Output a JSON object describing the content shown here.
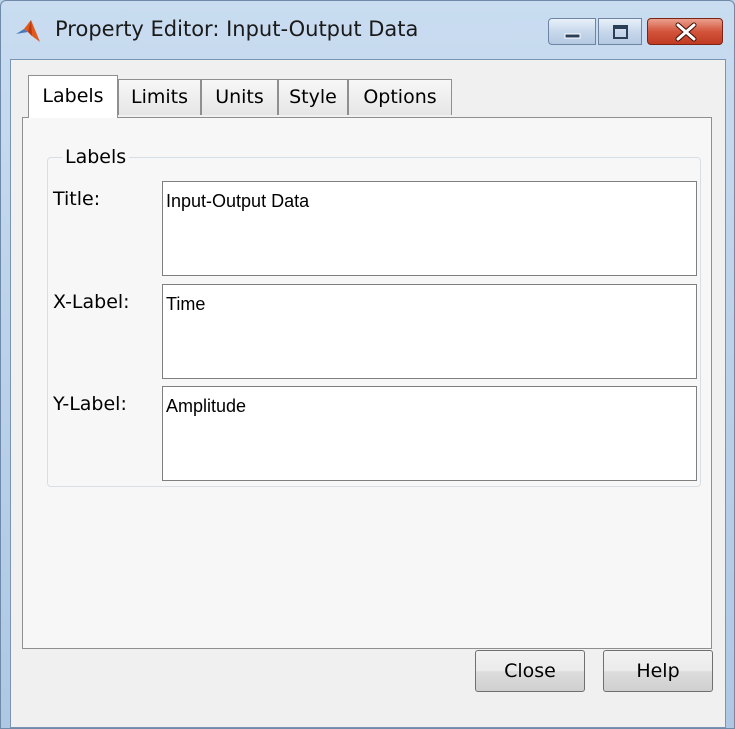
{
  "window": {
    "title": "Property Editor: Input-Output Data",
    "icon": "matlab-logo-icon",
    "controls": [
      "minimize-icon",
      "maximize-icon",
      "close-icon"
    ]
  },
  "tabs": [
    {
      "label": "Labels",
      "active": true
    },
    {
      "label": "Limits",
      "active": false
    },
    {
      "label": "Units",
      "active": false
    },
    {
      "label": "Style",
      "active": false
    },
    {
      "label": "Options",
      "active": false
    }
  ],
  "group": {
    "title": "Labels",
    "fields": [
      {
        "label": "Title:",
        "value": "Input-Output Data"
      },
      {
        "label": "X-Label:",
        "value": "Time"
      },
      {
        "label": "Y-Label:",
        "value": "Amplitude"
      }
    ]
  },
  "buttons": {
    "close": "Close",
    "help": "Help"
  },
  "colors": {
    "frame": "#bcd3ea",
    "panel": "#f7f7f7",
    "close_button": "#c13a22"
  }
}
